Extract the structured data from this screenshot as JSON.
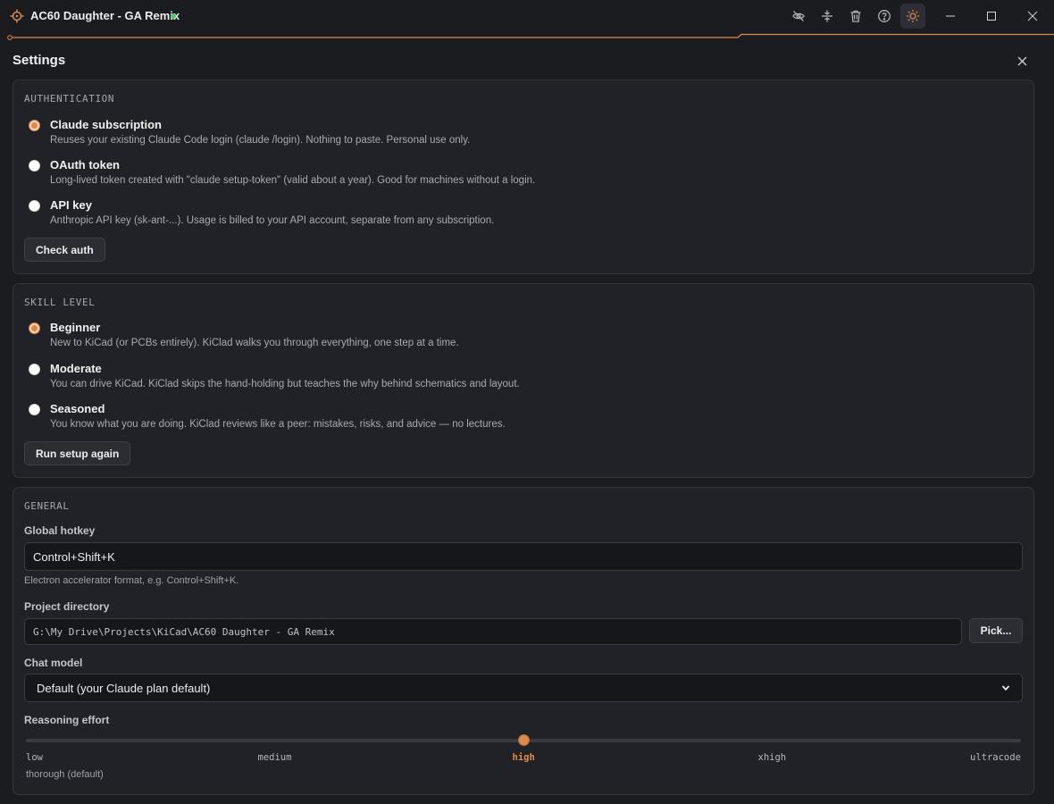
{
  "window": {
    "title": "AC60 Daughter - GA Remix",
    "accent_color": "#d98a4c",
    "status_color": "#4ec86a"
  },
  "toolbar": {
    "icons": [
      "eye-off-icon",
      "collapse-vertical-icon",
      "trash-icon",
      "help-icon",
      "sun-icon"
    ]
  },
  "settings": {
    "title": "Settings",
    "authentication": {
      "heading": "AUTHENTICATION",
      "options": [
        {
          "label": "Claude subscription",
          "description": "Reuses your existing Claude Code login (claude /login). Nothing to paste. Personal use only.",
          "selected": true
        },
        {
          "label": "OAuth token",
          "description": "Long-lived token created with \"claude setup-token\" (valid about a year). Good for machines without a login.",
          "selected": false
        },
        {
          "label": "API key",
          "description": "Anthropic API key (sk-ant-...). Usage is billed to your API account, separate from any subscription.",
          "selected": false
        }
      ],
      "button": "Check auth"
    },
    "skill_level": {
      "heading": "SKILL LEVEL",
      "options": [
        {
          "label": "Beginner",
          "description": "New to KiCad (or PCBs entirely). KiClad walks you through everything, one step at a time.",
          "selected": true
        },
        {
          "label": "Moderate",
          "description": "You can drive KiCad. KiClad skips the hand-holding but teaches the why behind schematics and layout.",
          "selected": false
        },
        {
          "label": "Seasoned",
          "description": "You know what you are doing. KiClad reviews like a peer: mistakes, risks, and advice — no lectures.",
          "selected": false
        }
      ],
      "button": "Run setup again"
    },
    "general": {
      "heading": "GENERAL",
      "hotkey": {
        "label": "Global hotkey",
        "value": "Control+Shift+K",
        "hint": "Electron accelerator format, e.g. Control+Shift+K."
      },
      "project": {
        "label": "Project directory",
        "value": "G:\\My Drive\\Projects\\KiCad\\AC60 Daughter - GA Remix",
        "button": "Pick..."
      },
      "model": {
        "label": "Chat model",
        "value": "Default (your Claude plan default)"
      },
      "effort": {
        "label": "Reasoning effort",
        "levels": [
          "low",
          "medium",
          "high",
          "xhigh",
          "ultracode"
        ],
        "selected_index": 2,
        "description": "thorough (default)"
      }
    }
  }
}
